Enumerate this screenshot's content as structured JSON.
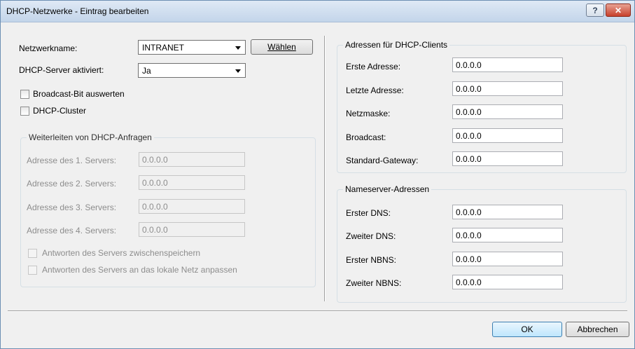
{
  "window": {
    "title": "DHCP-Netzwerke - Eintrag bearbeiten",
    "help_glyph": "?",
    "close_glyph": "✕"
  },
  "left": {
    "netzwerkname_label": "Netzwerkname:",
    "netzwerkname_value": "INTRANET",
    "waehlen_label": "Wählen",
    "dhcp_server_label": "DHCP-Server aktiviert:",
    "dhcp_server_value": "Ja",
    "broadcast_bit_label": "Broadcast-Bit auswerten",
    "broadcast_bit_checked": false,
    "dhcp_cluster_label": "DHCP-Cluster",
    "dhcp_cluster_checked": false
  },
  "forwarding": {
    "legend": "Weiterleiten von DHCP-Anfragen",
    "servers": [
      {
        "label": "Adresse des 1. Servers:",
        "value": "0.0.0.0"
      },
      {
        "label": "Adresse des 2. Servers:",
        "value": "0.0.0.0"
      },
      {
        "label": "Adresse des 3. Servers:",
        "value": "0.0.0.0"
      },
      {
        "label": "Adresse des 4. Servers:",
        "value": "0.0.0.0"
      }
    ],
    "cache_label": "Antworten des Servers zwischenspeichern",
    "adapt_label": "Antworten des Servers an das lokale Netz anpassen"
  },
  "clients": {
    "legend": "Adressen für DHCP-Clients",
    "rows": [
      {
        "label": "Erste Adresse:",
        "value": "0.0.0.0"
      },
      {
        "label": "Letzte Adresse:",
        "value": "0.0.0.0"
      },
      {
        "label": "Netzmaske:",
        "value": "0.0.0.0"
      },
      {
        "label": "Broadcast:",
        "value": "0.0.0.0"
      },
      {
        "label": "Standard-Gateway:",
        "value": "0.0.0.0"
      }
    ]
  },
  "nameserver": {
    "legend": "Nameserver-Adressen",
    "rows": [
      {
        "label": "Erster DNS:",
        "value": "0.0.0.0"
      },
      {
        "label": "Zweiter DNS:",
        "value": "0.0.0.0"
      },
      {
        "label": "Erster NBNS:",
        "value": "0.0.0.0"
      },
      {
        "label": "Zweiter NBNS:",
        "value": "0.0.0.0"
      }
    ]
  },
  "footer": {
    "ok_label": "OK",
    "cancel_label": "Abbrechen"
  }
}
